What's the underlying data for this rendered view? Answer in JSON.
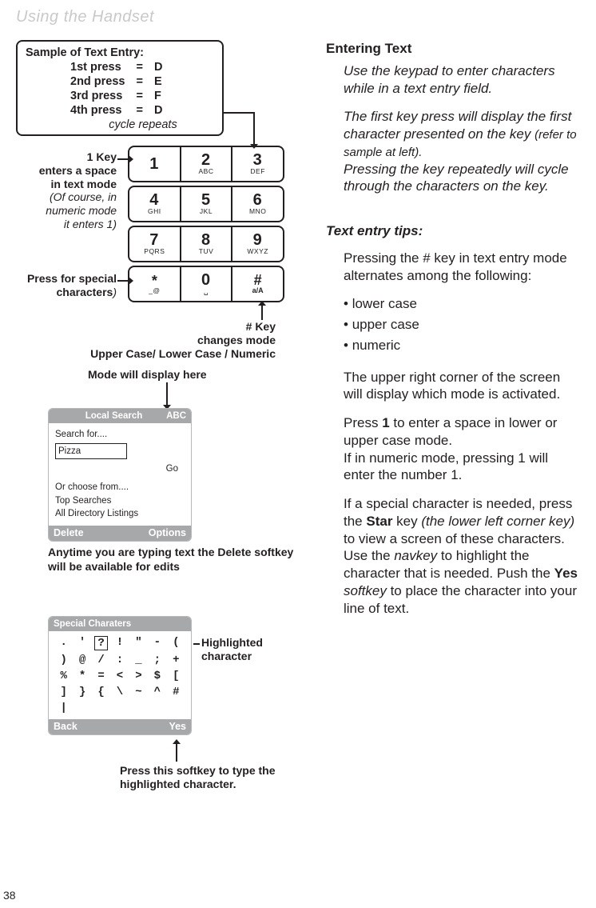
{
  "page": {
    "title": "Using the Handset",
    "number": "38"
  },
  "sample": {
    "title": "Sample of Text Entry:",
    "rows": [
      {
        "press": "1st press",
        "eq": "=",
        "ch": "D"
      },
      {
        "press": "2nd press",
        "eq": "=",
        "ch": "E"
      },
      {
        "press": "3rd press",
        "eq": "=",
        "ch": "F"
      },
      {
        "press": "4th press",
        "eq": "=",
        "ch": "D"
      }
    ],
    "cycle": "cycle repeats"
  },
  "keypad": {
    "keys": [
      [
        {
          "big": "1",
          "sub": ""
        },
        {
          "big": "2",
          "sub": "ABC"
        },
        {
          "big": "3",
          "sub": "DEF"
        }
      ],
      [
        {
          "big": "4",
          "sub": "GHI"
        },
        {
          "big": "5",
          "sub": "JKL"
        },
        {
          "big": "6",
          "sub": "MNO"
        }
      ],
      [
        {
          "big": "7",
          "sub": "PQRS"
        },
        {
          "big": "8",
          "sub": "TUV"
        },
        {
          "big": "9",
          "sub": "WXYZ"
        }
      ],
      [
        {
          "big": "*",
          "sub": "_@"
        },
        {
          "big": "0",
          "sub": "␣"
        },
        {
          "big": "#",
          "sub": "a/A"
        }
      ]
    ]
  },
  "ann": {
    "key1_title": "1 Key",
    "key1_l1": "enters a space",
    "key1_l2": "in text mode",
    "key1_l3": "(Of course, in",
    "key1_l4": "numeric mode",
    "key1_l5": "it enters 1)",
    "star": "Press for special\ncharacters",
    "star_suffix": ")",
    "hash_title": "# Key",
    "hash_l1": "changes mode",
    "hash_l2": "Upper Case/ Lower Case / Numeric",
    "mode_display": "Mode will display here",
    "delete_note": "Anytime you are typing text the Delete softkey will be available for edits",
    "highlighted": "Highlighted\ncharacter",
    "press_softkey": "Press this softkey to type the highlighted character."
  },
  "localSearch": {
    "title": "Local Search",
    "mode": "ABC",
    "searchFor": "Search for....",
    "value": "Pizza",
    "go": "Go",
    "orChoose": "Or choose from....",
    "top": "Top Searches",
    "all": "All Directory Listings",
    "left": "Delete",
    "right": "Options"
  },
  "specialChars": {
    "title": "Special Charaters",
    "grid": [
      ".",
      "'",
      "?",
      "!",
      "\"",
      "-",
      "(",
      ")",
      "@",
      "/",
      ":",
      "_",
      ";",
      "+",
      "%",
      "*",
      "=",
      "<",
      ">",
      "$",
      "[",
      "]",
      "}",
      "{",
      "\\",
      "~",
      "^",
      "#",
      "|"
    ],
    "highlight_index": 2,
    "left": "Back",
    "right": "Yes"
  },
  "right": {
    "heading": "Entering Text",
    "p1a": "Use the keypad to enter characters while in a text entry field.",
    "p1b_a": "The first key press will display the first character presented on the key ",
    "p1b_ref": "(refer to sample at left).",
    "p1c": "Pressing the key repeatedly will cycle through the characters on the key.",
    "tips_h": "Text entry tips:",
    "tips_1": "Pressing the # key in text entry mode alternates among the following:",
    "modes": [
      "lower case",
      "upper case",
      "numeric"
    ],
    "p2": "The upper right corner of the screen will display which mode is activated.",
    "p3a": "Press ",
    "p3key": "1",
    "p3b": " to enter a space in lower or upper case mode.",
    "p3c": "If in numeric mode, pressing 1 will enter the number 1.",
    "p4a": "If a special character is needed, press the ",
    "p4star": "Star",
    "p4b": " key ",
    "p4c_it": "(the lower left corner key)",
    "p4d": " to view a screen of these characters.",
    "p4e_a": "Use the ",
    "p4e_navkey": "navkey",
    "p4e_b": " to highlight the character that is needed. Push the ",
    "p4yes": "Yes",
    "p4e_c": " ",
    "p4e_softkey": "softkey",
    "p4e_d": " to place the character into your line of text."
  }
}
